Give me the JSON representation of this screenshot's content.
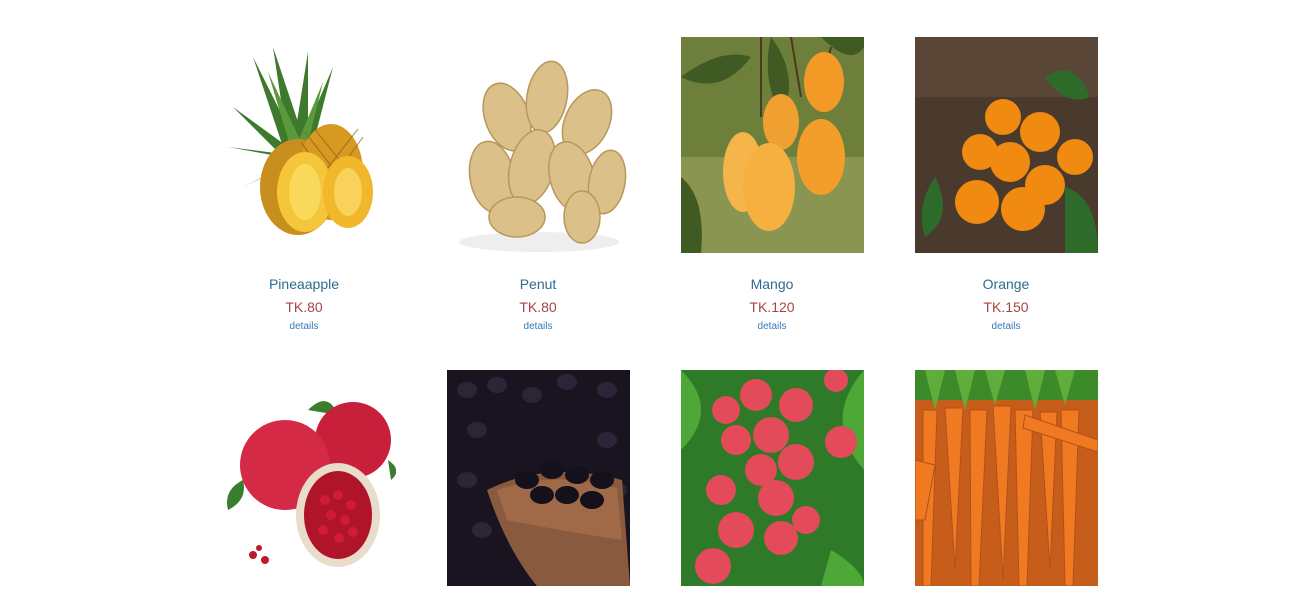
{
  "products": [
    {
      "name": "Pineaapple",
      "price": "TK.80",
      "details": "details",
      "image": "pineapple-image"
    },
    {
      "name": "Penut",
      "price": "TK.80",
      "details": "details",
      "image": "peanut-image"
    },
    {
      "name": "Mango",
      "price": "TK.120",
      "details": "details",
      "image": "mango-image"
    },
    {
      "name": "Orange",
      "price": "TK.150",
      "details": "details",
      "image": "orange-image"
    },
    {
      "image": "pomegranate-image"
    },
    {
      "image": "blackberry-image"
    },
    {
      "image": "lychee-image"
    },
    {
      "image": "carrot-image"
    }
  ]
}
